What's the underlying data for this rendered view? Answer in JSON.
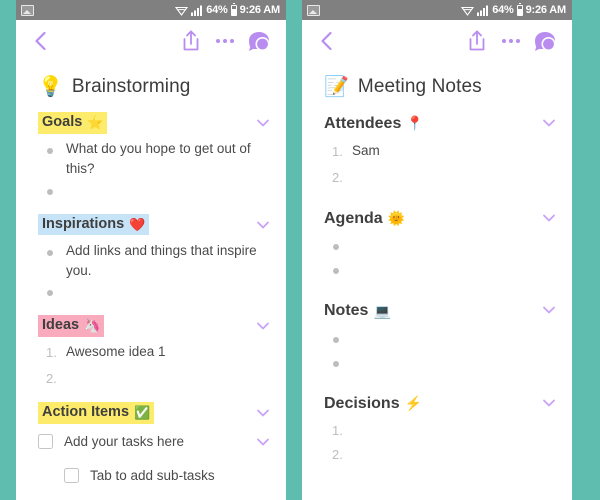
{
  "theme": {
    "background": "#5fbdb0",
    "panel": "#ffffff",
    "statusbar": "#808080",
    "accent_purple": "#b98cf0",
    "text_dark": "#3c3c3c",
    "text_body": "#4a4a4a",
    "muted": "#bdbdbd",
    "highlight_yellow": "#fdec6b",
    "highlight_blue": "#c7e3f7",
    "highlight_pink": "#f9aabc"
  },
  "statusbar": {
    "gallery_icon": "gallery-icon",
    "wifi_icon": "wifi-icon",
    "signal_icon": "signal-icon",
    "battery_level": "64%",
    "battery_icon": "battery-icon",
    "time": "9:26 AM"
  },
  "toolbar": {
    "back_icon": "back-chevron-icon",
    "share_icon": "share-icon",
    "more_icon": "more-options-icon",
    "chat_icon": "chat-bubble-icon"
  },
  "screens": [
    {
      "id": "brainstorming",
      "title": "Brainstorming",
      "title_emoji": "💡",
      "sections": [
        {
          "title": "Goals",
          "emoji": "⭐",
          "highlight": "hl-yellow",
          "list_type": "bullet",
          "items": [
            {
              "marker": "•",
              "text": "What do you hope to get out of this?"
            },
            {
              "marker": "•",
              "text": ""
            }
          ]
        },
        {
          "title": "Inspirations",
          "emoji": "❤️",
          "highlight": "hl-blue",
          "list_type": "bullet",
          "items": [
            {
              "marker": "•",
              "text": "Add links and things that inspire you."
            },
            {
              "marker": "•",
              "text": ""
            }
          ]
        },
        {
          "title": "Ideas",
          "emoji": "🦄",
          "highlight": "hl-pink",
          "list_type": "number",
          "items": [
            {
              "marker": "1.",
              "text": "Awesome idea 1"
            },
            {
              "marker": "2.",
              "text": ""
            }
          ]
        },
        {
          "title": "Action Items",
          "emoji": "✅",
          "highlight": "hl-yellow",
          "list_type": "checkbox",
          "items": [
            {
              "marker": "checkbox",
              "text": "Add your tasks here",
              "sub": false,
              "chevron": true
            },
            {
              "marker": "checkbox",
              "text": "Tab to add sub-tasks",
              "sub": true,
              "chevron": false
            }
          ]
        }
      ]
    },
    {
      "id": "meeting-notes",
      "title": "Meeting Notes",
      "title_emoji": "📝",
      "sections": [
        {
          "title": "Attendees",
          "emoji": "📍",
          "highlight": "hl-none",
          "list_type": "number",
          "items": [
            {
              "marker": "1.",
              "text": "Sam"
            },
            {
              "marker": "2.",
              "text": ""
            }
          ]
        },
        {
          "title": "Agenda",
          "emoji": "🌞",
          "highlight": "hl-none",
          "list_type": "bullet",
          "items": [
            {
              "marker": "•",
              "text": ""
            },
            {
              "marker": "•",
              "text": ""
            }
          ]
        },
        {
          "title": "Notes",
          "emoji": "💻",
          "highlight": "hl-none",
          "list_type": "bullet",
          "items": [
            {
              "marker": "•",
              "text": ""
            },
            {
              "marker": "•",
              "text": ""
            }
          ]
        },
        {
          "title": "Decisions",
          "emoji": "⚡",
          "highlight": "hl-none",
          "list_type": "number",
          "items": [
            {
              "marker": "1.",
              "text": ""
            },
            {
              "marker": "2.",
              "text": ""
            }
          ]
        }
      ]
    }
  ]
}
